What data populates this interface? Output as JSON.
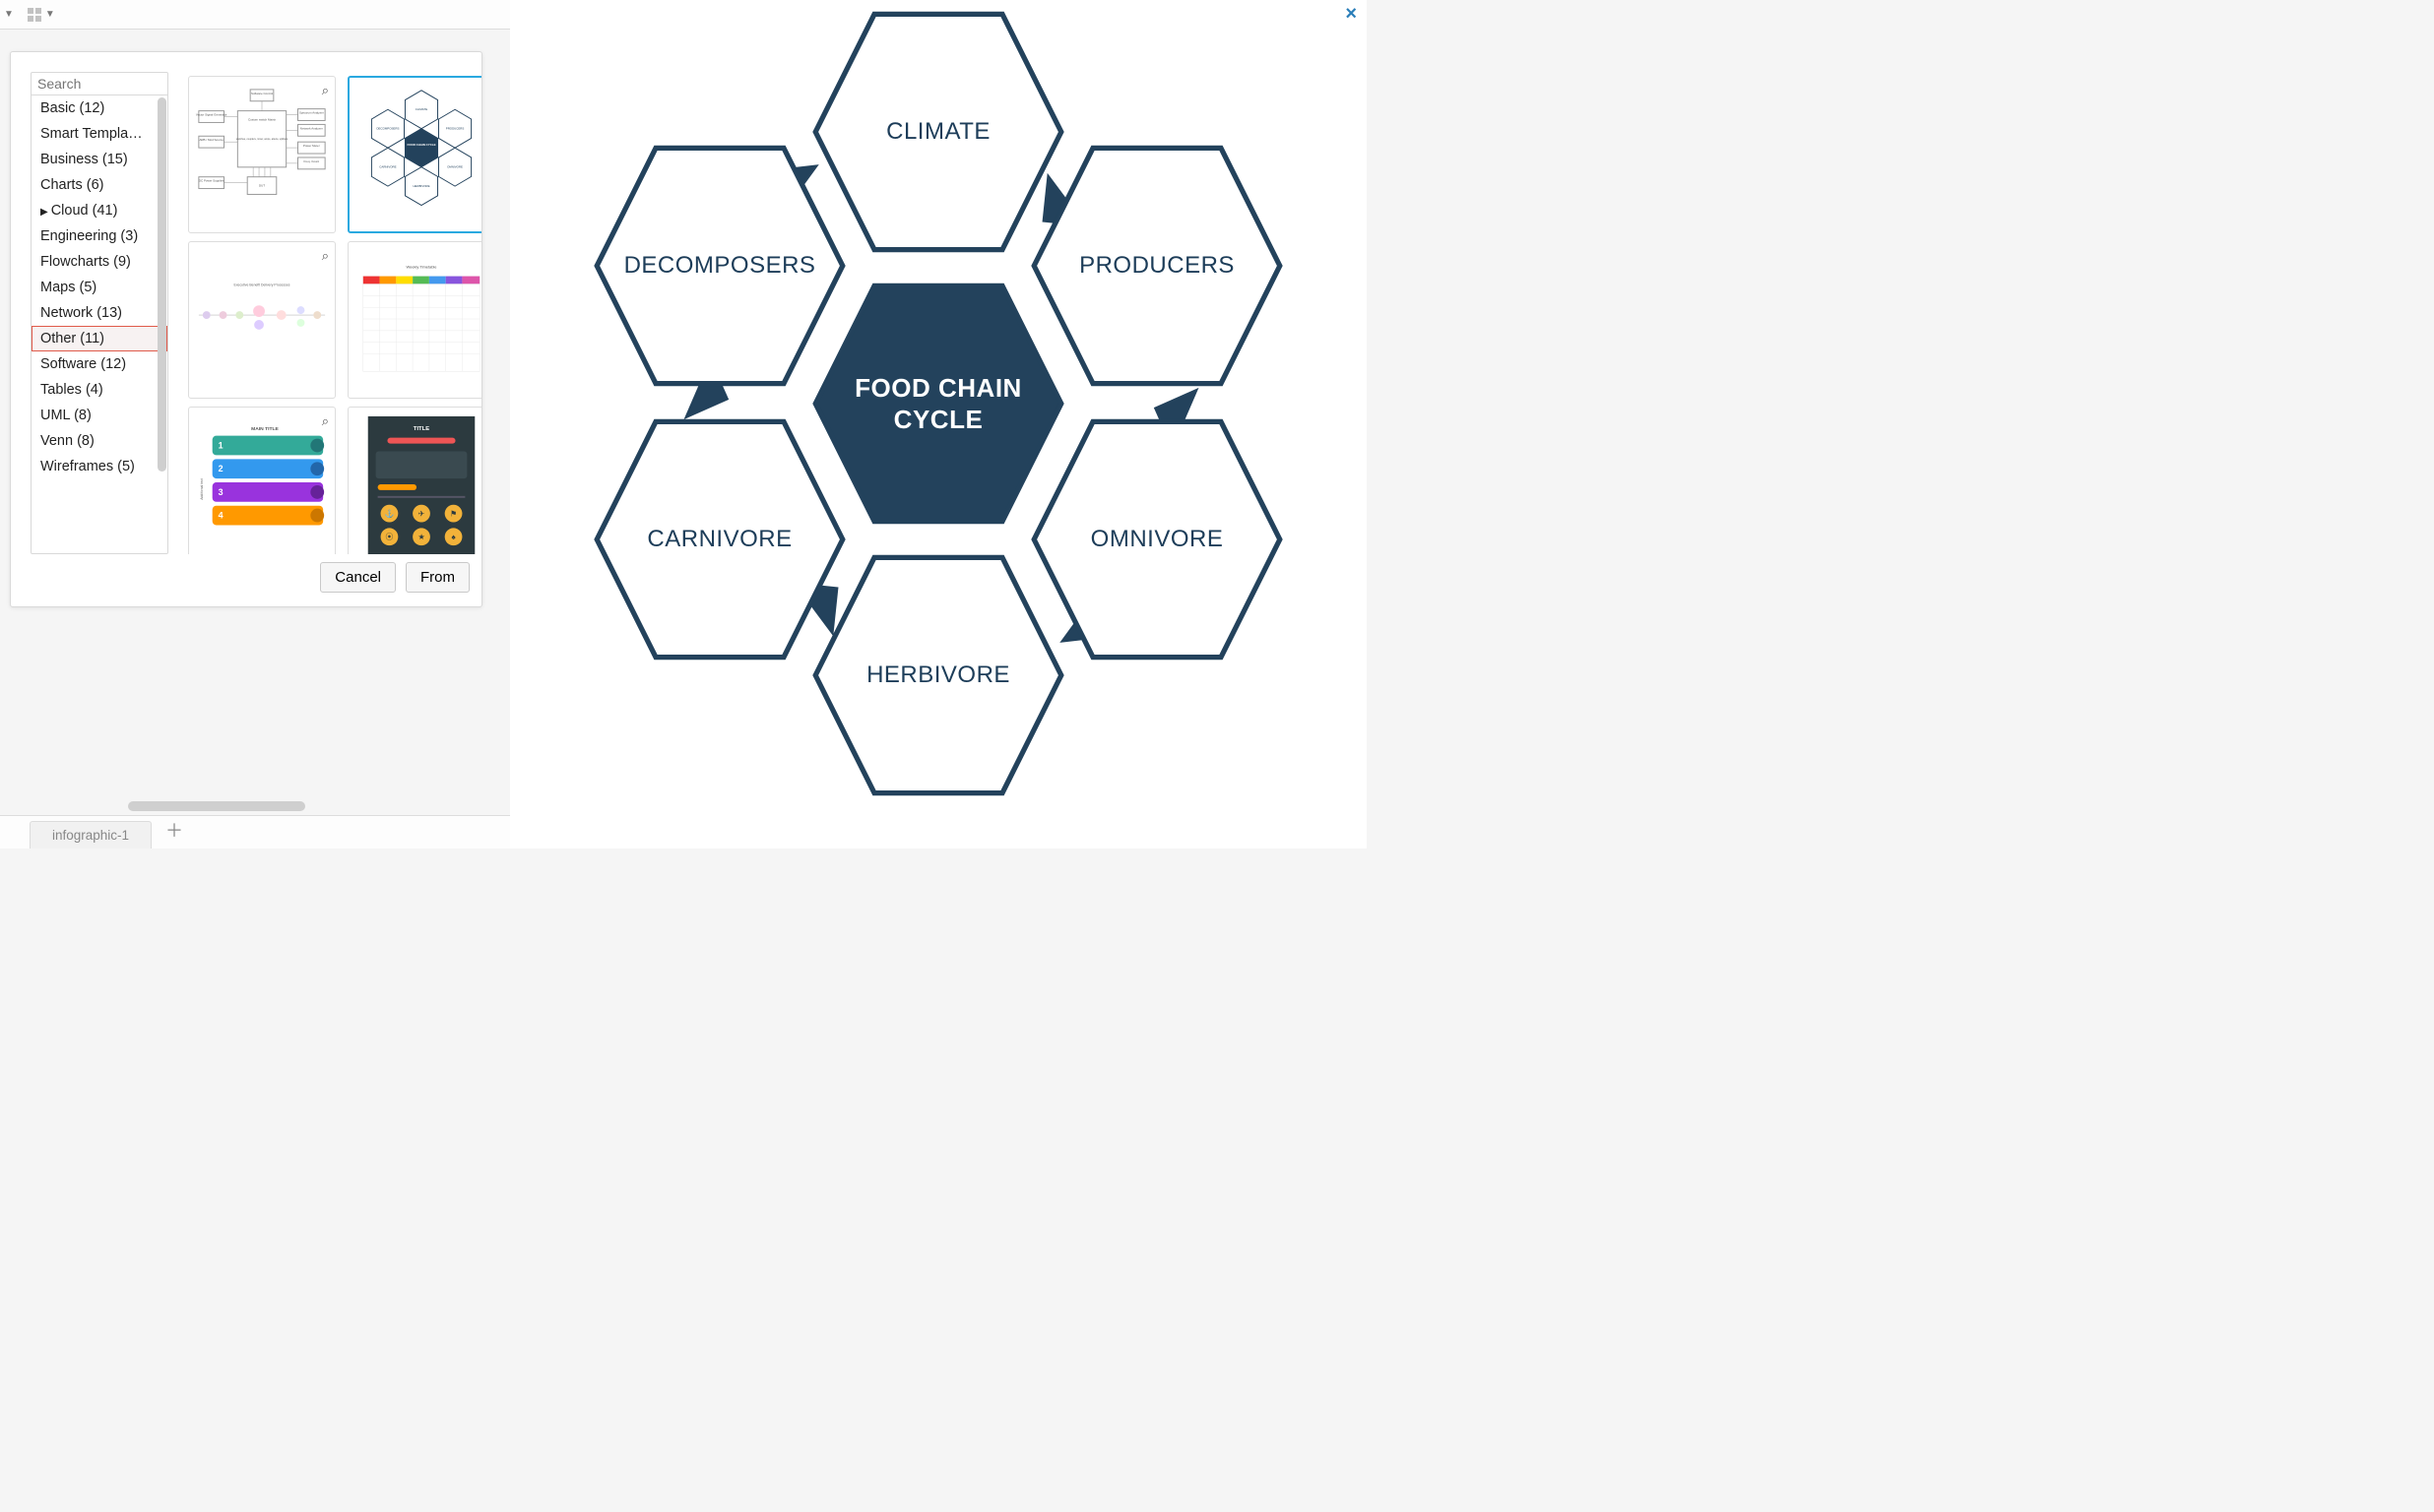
{
  "colors": {
    "hexStroke": "#23425c",
    "hexFill": "#23425c"
  },
  "toolbar": {},
  "dialog": {
    "search_placeholder": "Search",
    "categories": [
      {
        "label": "Basic (12)"
      },
      {
        "label": "Smart Templa…"
      },
      {
        "label": "Business (15)"
      },
      {
        "label": "Charts (6)"
      },
      {
        "label": "Cloud (41)",
        "expandable": true
      },
      {
        "label": "Engineering (3)"
      },
      {
        "label": "Flowcharts (9)"
      },
      {
        "label": "Maps (5)"
      },
      {
        "label": "Network (13)"
      },
      {
        "label": "Other (11)",
        "highlight": true
      },
      {
        "label": "Software (12)"
      },
      {
        "label": "Tables (4)"
      },
      {
        "label": "UML (8)"
      },
      {
        "label": "Venn (8)"
      },
      {
        "label": "Wireframes (5)"
      }
    ],
    "buttons": {
      "cancel": "Cancel",
      "from": "From"
    }
  },
  "tabs": {
    "page1": "infographic-1"
  },
  "preview": {
    "center_line1": "FOOD CHAIN",
    "center_line2": "CYCLE",
    "top": "CLIMATE",
    "tl": "DECOMPOSERS",
    "tr": "PRODUCERS",
    "bl": "CARNIVORE",
    "br": "OMNIVORE",
    "bot": "HERBIVORE"
  },
  "thumbnails": {
    "t1": {
      "a": "Software Control",
      "b": "Vector Signal Generator",
      "c": "Custom switch Matrix",
      "d": "switches, couplers, mixer, amps, attens, splitters",
      "e": "ARB / Mod Source",
      "f": "DC Power Supplies",
      "g": "DUT",
      "h": "Spectrum Analyzer",
      "i": "Network Analyzer",
      "j": "Power Meter",
      "k": "Freq. Count"
    },
    "t2": {
      "center": "FOOD CHAIN CYCLE",
      "top": "CLIMATE",
      "tl": "DECOMPOSERS",
      "tr": "PRODUCERS",
      "bl": "CARNIVORE",
      "br": "OMNIVORE",
      "bot": "HERBIVORE"
    },
    "t3": {
      "title": "Executive Benefit Delivery Processes"
    },
    "t4": {
      "title": "Weekly Timetable"
    },
    "t5": {
      "title": "MAIN TITLE",
      "side": "Additional text"
    },
    "t6": {
      "title": "TITLE"
    }
  }
}
